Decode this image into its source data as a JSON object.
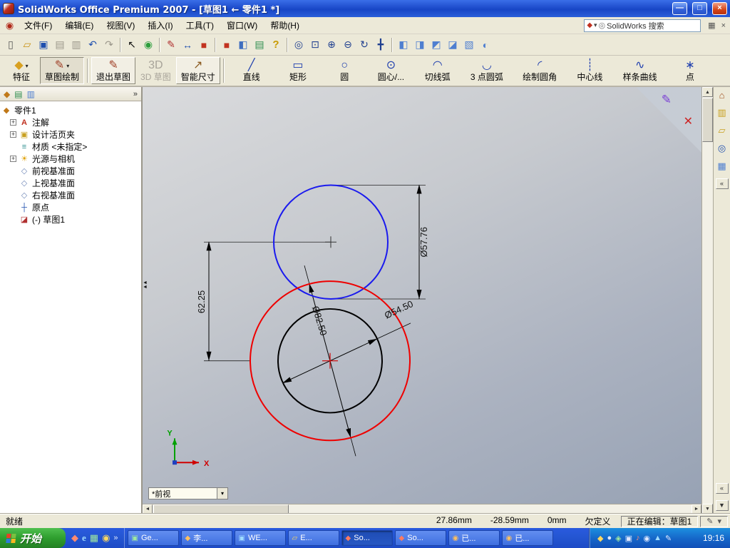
{
  "titlebar": {
    "title": "SolidWorks Office Premium 2007 - [草图1 ← 零件1 *]",
    "minimize_glyph": "—",
    "restore_glyph": "□",
    "close_glyph": "×"
  },
  "menubar": {
    "app_icon_glyph": "◉",
    "items": [
      "文件(F)",
      "编辑(E)",
      "视图(V)",
      "插入(I)",
      "工具(T)",
      "窗口(W)",
      "帮助(H)"
    ],
    "search": {
      "flame_glyph": "◆",
      "caret_glyph": "▾",
      "glass_glyph": "◎",
      "value": "SolidWorks 搜索"
    },
    "extra_icons": [
      {
        "name": "workspace",
        "glyph": "▦"
      },
      {
        "name": "close-document",
        "glyph": "×"
      }
    ]
  },
  "toolbar_main": {
    "icons": [
      {
        "name": "new-document",
        "glyph": "▯"
      },
      {
        "name": "open",
        "glyph": "▱"
      },
      {
        "name": "save",
        "glyph": "▣"
      },
      {
        "name": "print",
        "glyph": "▤"
      },
      {
        "name": "print-preview",
        "glyph": "▥"
      },
      {
        "name": "undo",
        "glyph": "↶"
      },
      {
        "name": "redo",
        "glyph": "↷"
      },
      {
        "name": "select",
        "glyph": "↖"
      },
      {
        "name": "rebuild",
        "glyph": "◉"
      },
      {
        "name": "sketch",
        "glyph": "✎"
      },
      {
        "name": "smart-dimension",
        "glyph": "↔"
      },
      {
        "name": "extrude-feature",
        "glyph": "■"
      },
      {
        "name": "part-color",
        "glyph": "■"
      },
      {
        "name": "section-view",
        "glyph": "◧"
      },
      {
        "name": "annotation",
        "glyph": "▤"
      },
      {
        "name": "help",
        "glyph": "?"
      },
      {
        "name": "zoom-fit",
        "glyph": "◎"
      },
      {
        "name": "zoom-area",
        "glyph": "⊡"
      },
      {
        "name": "zoom-in",
        "glyph": "⊕"
      },
      {
        "name": "zoom-out",
        "glyph": "⊖"
      },
      {
        "name": "rotate-view",
        "glyph": "↻"
      },
      {
        "name": "pan",
        "glyph": "╋"
      },
      {
        "name": "view-front",
        "glyph": "◧"
      },
      {
        "name": "view-top",
        "glyph": "◨"
      },
      {
        "name": "view-left",
        "glyph": "◩"
      },
      {
        "name": "view-iso",
        "glyph": "◪"
      },
      {
        "name": "wireframe",
        "glyph": "▧"
      },
      {
        "name": "shaded",
        "glyph": "◐"
      }
    ]
  },
  "command_bar": {
    "buttons": [
      {
        "label": "特征",
        "glyph": "◆",
        "caret": "▾"
      },
      {
        "label": "草图绘制",
        "glyph": "✎",
        "caret": "▾"
      },
      {
        "label": "退出草图",
        "glyph": "✎"
      },
      {
        "label": "3D 草图",
        "glyph": "3D"
      },
      {
        "label": "智能尺寸",
        "glyph": "↗"
      },
      {
        "label": "直线",
        "glyph": "╱"
      },
      {
        "label": "矩形",
        "glyph": "▭"
      },
      {
        "label": "圆",
        "glyph": "○"
      },
      {
        "label": "圆心/...",
        "glyph": "⊙"
      },
      {
        "label": "切线弧",
        "glyph": "◠"
      },
      {
        "label": "3 点圆弧",
        "glyph": "◡"
      },
      {
        "label": "绘制圆角",
        "glyph": "◜"
      },
      {
        "label": "中心线",
        "glyph": "┊"
      },
      {
        "label": "样条曲线",
        "glyph": "∿"
      },
      {
        "label": "点",
        "glyph": "∗"
      }
    ]
  },
  "feature_tree": {
    "tabs": {
      "overflow": "»"
    },
    "root": {
      "label": "零件1",
      "glyph": "◆"
    },
    "items": [
      {
        "label": "注解",
        "glyph": "A",
        "expander": "+"
      },
      {
        "label": "设计活页夹",
        "glyph": "▣",
        "expander": "+"
      },
      {
        "label": "材质 <未指定>",
        "glyph": "≡",
        "expander": ""
      },
      {
        "label": "光源与相机",
        "glyph": "☀",
        "expander": "+"
      },
      {
        "label": "前视基准面",
        "glyph": "◇",
        "expander": ""
      },
      {
        "label": "上视基准面",
        "glyph": "◇",
        "expander": ""
      },
      {
        "label": "右视基准面",
        "glyph": "◇",
        "expander": ""
      },
      {
        "label": "原点",
        "glyph": "┼",
        "expander": ""
      },
      {
        "label": "(-) 草图1",
        "glyph": "◪",
        "expander": ""
      }
    ]
  },
  "viewport": {
    "view_selector": {
      "value": "*前视",
      "caret": "▾"
    },
    "confirmation": {
      "accept_glyph": "✎",
      "cancel_glyph": "✕"
    },
    "splitter_glyph": "◄\n◄",
    "triad": {
      "x_label": "X",
      "y_label": "Y"
    },
    "sketch": {
      "circles": [
        {
          "name": "top-circle",
          "color": "#1a1aee",
          "diameter": "Ø57.76"
        },
        {
          "name": "outer-circle",
          "color": "#ee0000",
          "diameter": "Ø82.50"
        },
        {
          "name": "inner-circle",
          "color": "#000000",
          "diameter": "Ø54.50"
        }
      ],
      "center_distance": "62.25"
    }
  },
  "scrollbar": {
    "up": "▲",
    "down": "▼",
    "left": "◄",
    "right": "►"
  },
  "right_rail": {
    "icons": [
      {
        "name": "resources",
        "glyph": "⌂"
      },
      {
        "name": "design-library",
        "glyph": "▥"
      },
      {
        "name": "file-explorer",
        "glyph": "▱"
      },
      {
        "name": "search",
        "glyph": "◎"
      },
      {
        "name": "view-palette",
        "glyph": "▦"
      }
    ],
    "collapse": "«",
    "down": "▼"
  },
  "statusbar": {
    "message": "就绪",
    "coord_x": "27.86mm",
    "coord_y": "-28.59mm",
    "coord_z": "0mm",
    "constraint_state": "欠定义",
    "editing": "正在编辑：草图1",
    "icons": [
      "✎",
      "▾"
    ]
  },
  "taskbar": {
    "start_label": "开始",
    "quick_launch": [
      {
        "name": "solidworks",
        "glyph": "◆"
      },
      {
        "name": "internet-explorer",
        "glyph": "e"
      },
      {
        "name": "show-desktop",
        "glyph": "▦"
      },
      {
        "name": "media-player",
        "glyph": "◉"
      }
    ],
    "overflow": "»",
    "windows": [
      {
        "label": "Ge...",
        "glyph": "▣",
        "active": false
      },
      {
        "label": "李...",
        "glyph": "◆",
        "active": false
      },
      {
        "label": "WE...",
        "glyph": "▣",
        "active": false
      },
      {
        "label": "E...",
        "glyph": "▱",
        "active": false
      },
      {
        "label": "So...",
        "glyph": "◆",
        "active": true
      },
      {
        "label": "So...",
        "glyph": "◆",
        "active": false
      },
      {
        "label": "已...",
        "glyph": "◉",
        "active": false
      },
      {
        "label": "已...",
        "glyph": "◉",
        "active": false
      }
    ],
    "tray_icons": [
      "◆",
      "●",
      "◈",
      "▣",
      "♪",
      "◉",
      "▲",
      "✎"
    ],
    "time": "19:16"
  }
}
